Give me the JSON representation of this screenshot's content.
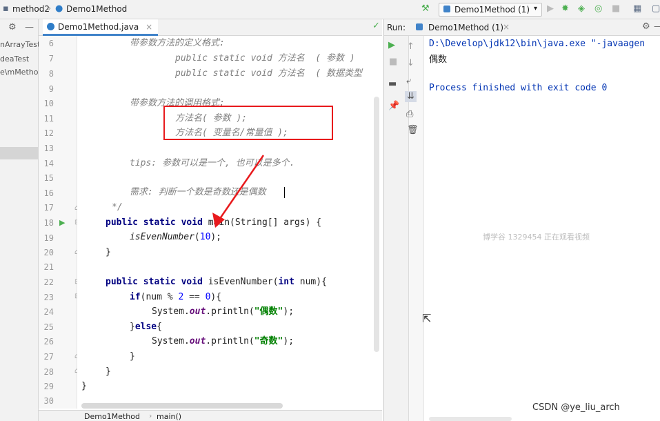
{
  "navbar": {
    "project": "method2",
    "file": "Demo1Method",
    "run_config": "Demo1Method (1)"
  },
  "project_tree": {
    "items": [
      "nArrayTest",
      "deaTest",
      "e\\mMetho"
    ]
  },
  "editor": {
    "tab_label": "Demo1Method.java",
    "lines": [
      {
        "n": "6"
      },
      {
        "n": "7"
      },
      {
        "n": "8"
      },
      {
        "n": "9"
      },
      {
        "n": "10"
      },
      {
        "n": "11"
      },
      {
        "n": "12"
      },
      {
        "n": "13"
      },
      {
        "n": "14"
      },
      {
        "n": "15"
      },
      {
        "n": "16"
      },
      {
        "n": "17"
      },
      {
        "n": "18"
      },
      {
        "n": "19"
      },
      {
        "n": "20"
      },
      {
        "n": "21"
      },
      {
        "n": "22"
      },
      {
        "n": "23"
      },
      {
        "n": "24"
      },
      {
        "n": "25"
      },
      {
        "n": "26"
      },
      {
        "n": "27"
      },
      {
        "n": "28"
      },
      {
        "n": "29"
      },
      {
        "n": "30"
      }
    ],
    "code": {
      "l6": "带参数方法的定义格式:",
      "l7": "public static void 方法名  ( 参数 )",
      "l8": "public static void 方法名  ( 数据类型",
      "l10": "带参数方法的调用格式:",
      "l11": "方法名( 参数 );",
      "l12": "方法名( 变量名/常量值 );",
      "l14": "tips: 参数可以是一个, 也可以是多个.",
      "l16": "需求: 判断一个数是奇数还是偶数",
      "l17": "*/",
      "l18_kw": "public static void ",
      "l18_rest": "main(String[] args) {",
      "l19_call": "isEvenNumber",
      "l19_open": "(",
      "l19_num": "10",
      "l19_close": ");",
      "l20": "}",
      "l22_kw": "public static void ",
      "l22_name": "isEvenNumber(",
      "l22_int": "int",
      "l22_rest": " num){",
      "l23_if": "if",
      "l23_a": "(num % ",
      "l23_n2": "2",
      "l23_b": " == ",
      "l23_n0": "0",
      "l23_c": "){",
      "l24_sys": "System.",
      "l24_out": "out",
      "l24_call": ".println(",
      "l24_str": "\"偶数\"",
      "l24_end": ");",
      "l25_a": "}",
      "l25_else": "else",
      "l25_b": "{",
      "l26_sys": "System.",
      "l26_out": "out",
      "l26_call": ".println(",
      "l26_str": "\"奇数\"",
      "l26_end": ");",
      "l27": "}",
      "l28": "}",
      "l29": "}"
    }
  },
  "status_bar": {
    "crumb1": "Demo1Method",
    "crumb2": "main()"
  },
  "run_panel": {
    "label": "Run:",
    "tab_label": "Demo1Method (1)",
    "console": {
      "line1": "D:\\Develop\\jdk12\\bin\\java.exe \"-javaagen",
      "line2": "偶数",
      "line3": "Process finished with exit code 0"
    }
  },
  "watermark": "博学谷 1329454 正在观看视频",
  "csdn_mark": "CSDN @ye_liu_arch",
  "colors": {
    "accent": "#4083c9",
    "annotation_red": "#e8191c",
    "keyword": "#000080",
    "comment": "#808080",
    "string": "#008000",
    "number": "#0000ff",
    "run_green": "#4caf50",
    "console_blue": "#0033b3"
  },
  "icons": [
    "folder-icon",
    "class-icon",
    "hammer-icon",
    "play-icon",
    "debug-icon",
    "coverage-icon",
    "profile-icon",
    "stop-icon",
    "structure-icon",
    "settings-icon",
    "collapse-icon",
    "rerun-icon",
    "pin-icon",
    "soft-wrap-icon",
    "scroll-end-icon",
    "print-icon",
    "trash-icon",
    "checkmark-icon",
    "mouse-cursor-icon",
    "arrow-annotation-icon"
  ]
}
